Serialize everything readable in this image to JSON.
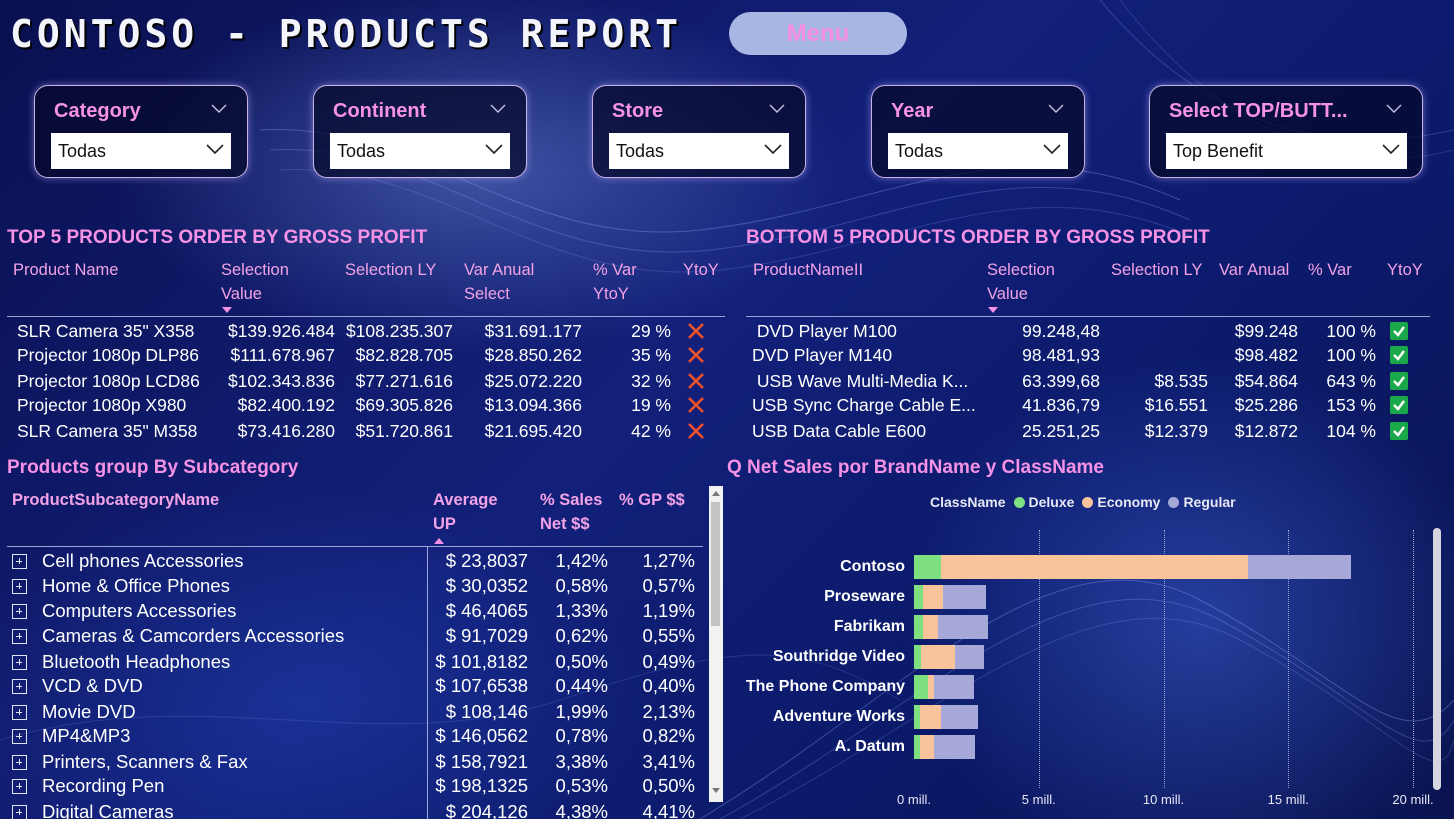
{
  "header": {
    "title": "CONTOSO - PRODUCTS REPORT",
    "menu_label": "Menu"
  },
  "slicers": [
    {
      "label": "Category",
      "value": "Todas"
    },
    {
      "label": "Continent",
      "value": "Todas"
    },
    {
      "label": "Store",
      "value": "Todas"
    },
    {
      "label": "Year",
      "value": "Todas"
    },
    {
      "label": "Select TOP/BUTT...",
      "value": "Top Benefit"
    }
  ],
  "top5": {
    "title": "TOP 5 PRODUCTS ORDER BY GROSS PROFIT",
    "columns": [
      "Product Name",
      "Selection Value",
      "Selection LY",
      "Var Anual Select",
      "% Var YtoY",
      "YtoY"
    ],
    "rows": [
      [
        "SLR Camera 35\" X358",
        "$139.926.484",
        "$108.235.307",
        "$31.691.177",
        "29 %"
      ],
      [
        "Projector 1080p DLP86",
        "$111.678.967",
        "$82.828.705",
        "$28.850.262",
        "35 %"
      ],
      [
        "Projector 1080p LCD86",
        "$102.343.836",
        "$77.271.616",
        "$25.072.220",
        "32 %"
      ],
      [
        "Projector 1080p X980",
        "$82.400.192",
        "$69.305.826",
        "$13.094.366",
        "19 %"
      ],
      [
        "SLR Camera 35\" M358",
        "$73.416.280",
        "$51.720.861",
        "$21.695.420",
        "42 %"
      ]
    ],
    "indicator": "cross"
  },
  "bottom5": {
    "title": "BOTTOM 5 PRODUCTS ORDER BY GROSS PROFIT",
    "columns": [
      "ProductNameII",
      "Selection Value",
      "Selection LY",
      "Var Anual",
      "% Var",
      "YtoY"
    ],
    "rows": [
      [
        " DVD Player M100",
        "99.248,48",
        "",
        "$99.248",
        "100 %"
      ],
      [
        "DVD Player M140",
        "98.481,93",
        "",
        "$98.482",
        "100 %"
      ],
      [
        " USB Wave Multi-Media K...",
        "63.399,68",
        "$8.535",
        "$54.864",
        "643 %"
      ],
      [
        "USB Sync Charge Cable E...",
        "41.836,79",
        "$16.551",
        "$25.286",
        "153 %"
      ],
      [
        "USB Data Cable E600",
        "25.251,25",
        "$12.379",
        "$12.872",
        "104 %"
      ]
    ],
    "indicator": "check"
  },
  "subcat": {
    "title": "Products group By Subcategory",
    "columns": [
      "ProductSubcategoryName",
      "Average UP",
      "% Sales Net $$",
      "% GP $$"
    ],
    "rows": [
      [
        "Cell phones Accessories",
        "$ 23,8037",
        "1,42%",
        "1,27%"
      ],
      [
        "Home & Office Phones",
        "$ 30,0352",
        "0,58%",
        "0,57%"
      ],
      [
        "Computers Accessories",
        "$ 46,4065",
        "1,33%",
        "1,19%"
      ],
      [
        "Cameras & Camcorders Accessories",
        "$ 91,7029",
        "0,62%",
        "0,55%"
      ],
      [
        "Bluetooth Headphones",
        "$ 101,8182",
        "0,50%",
        "0,49%"
      ],
      [
        "VCD & DVD",
        "$ 107,6538",
        "0,44%",
        "0,40%"
      ],
      [
        "Movie DVD",
        "$ 108,146",
        "1,99%",
        "2,13%"
      ],
      [
        "MP4&MP3",
        "$ 146,0562",
        "0,78%",
        "0,82%"
      ],
      [
        "Printers, Scanners & Fax",
        "$ 158,7921",
        "3,38%",
        "3,41%"
      ],
      [
        "Recording Pen",
        "$ 198,1325",
        "0,53%",
        "0,50%"
      ],
      [
        "Digital Cameras",
        "$ 204,126",
        "4,38%",
        "4,41%"
      ]
    ]
  },
  "chart_data": {
    "type": "bar",
    "orientation": "horizontal",
    "stacked": true,
    "title": "Q Net Sales por BrandName y ClassName",
    "legend_title": "ClassName",
    "categories": [
      "Contoso",
      "Proseware",
      "Fabrikam",
      "Southridge Video",
      "The Phone Company",
      "Adventure Works",
      "A. Datum"
    ],
    "series": [
      {
        "name": "Deluxe",
        "color": "#7fe07f",
        "values": [
          1.1,
          0.35,
          0.35,
          0.3,
          0.55,
          0.25,
          0.25
        ]
      },
      {
        "name": "Economy",
        "color": "#f9c49a",
        "values": [
          12.3,
          0.8,
          0.6,
          1.35,
          0.25,
          0.85,
          0.55
        ]
      },
      {
        "name": "Regular",
        "color": "#a6a8d8",
        "values": [
          4.1,
          1.75,
          2.0,
          1.15,
          1.6,
          1.45,
          1.65
        ]
      }
    ],
    "xlim": [
      0,
      20
    ],
    "xticks": [
      "0 mill.",
      "5 mill.",
      "10 mill.",
      "15 mill.",
      "20 mill."
    ],
    "legend_position": "top",
    "grid": true
  }
}
